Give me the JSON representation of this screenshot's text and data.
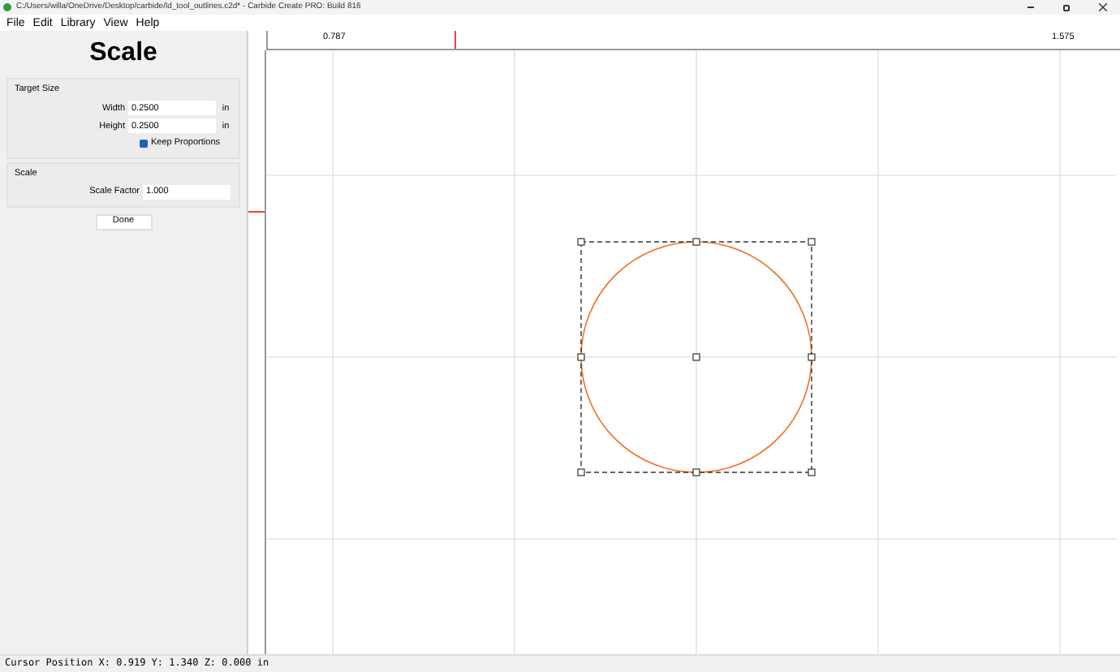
{
  "window": {
    "title": "C:/Users/willa/OneDrive/Desktop/carbide/ld_tool_outlines.c2d* - Carbide Create PRO: Build 816"
  },
  "menu": [
    "File",
    "Edit",
    "Library",
    "View",
    "Help"
  ],
  "panel": {
    "title": "Scale",
    "target_size": {
      "heading": "Target Size",
      "fields": [
        {
          "label": "Width",
          "value": "0.2500",
          "unit": "in"
        },
        {
          "label": "Height",
          "value": "0.2500",
          "unit": "in"
        }
      ],
      "keep_proportions": {
        "label": "Keep Proportions",
        "checked": true
      }
    },
    "scale": {
      "heading": "Scale",
      "field": {
        "label": "Scale Factor",
        "value": "1.000"
      }
    },
    "done_button": "Done"
  },
  "ruler": {
    "labels": [
      "0.787",
      "1.575"
    ]
  },
  "status_bar": "Cursor Position X: 0.919 Y: 1.340 Z: 0.000 in"
}
